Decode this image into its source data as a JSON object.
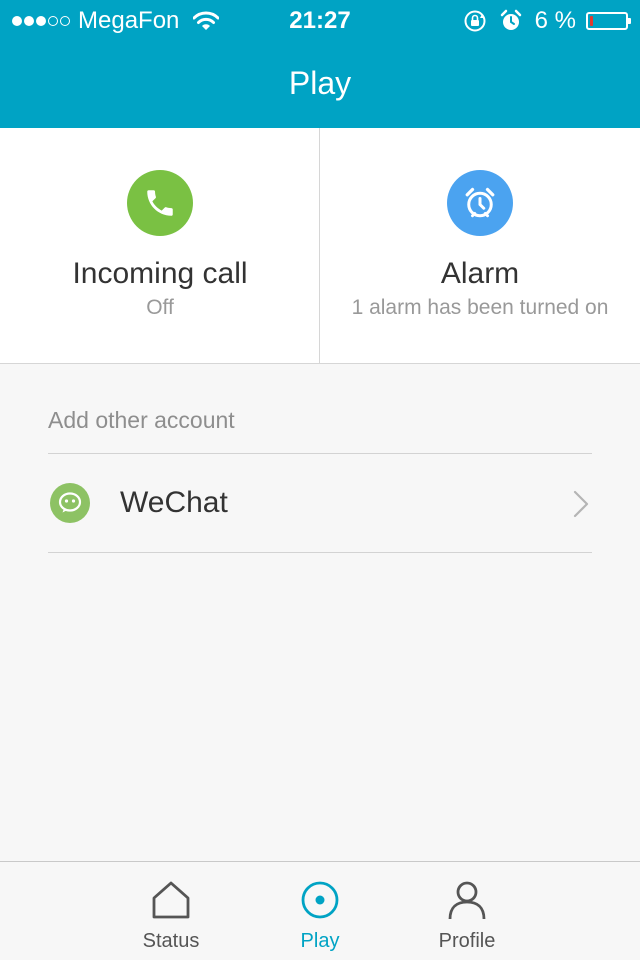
{
  "status_bar": {
    "carrier": "MegaFon",
    "signal_bars_filled": 3,
    "signal_bars_total": 5,
    "time": "21:27",
    "battery_percent_label": "6 %",
    "battery_level": 0.06,
    "icons": [
      "wifi-icon",
      "orientation-lock-icon",
      "alarm-clock-icon",
      "battery-icon"
    ]
  },
  "header": {
    "title": "Play"
  },
  "tiles": [
    {
      "title": "Incoming call",
      "subtitle": "Off",
      "icon": "phone-icon",
      "icon_color": "#7ac143"
    },
    {
      "title": "Alarm",
      "subtitle": "1 alarm has been turned on",
      "icon": "alarm-icon",
      "icon_color": "#4ba3f0"
    }
  ],
  "accounts": {
    "section_label": "Add other account",
    "items": [
      {
        "label": "WeChat",
        "icon": "wechat-icon",
        "icon_color": "#8dc264"
      }
    ]
  },
  "tabbar": {
    "tabs": [
      {
        "label": "Status",
        "icon": "home-icon",
        "active": false
      },
      {
        "label": "Play",
        "icon": "play-target-icon",
        "active": true
      },
      {
        "label": "Profile",
        "icon": "person-icon",
        "active": false
      }
    ]
  },
  "colors": {
    "accent": "#00a3c4",
    "background": "#f7f7f7",
    "text_primary": "#333333",
    "text_secondary": "#999999"
  }
}
